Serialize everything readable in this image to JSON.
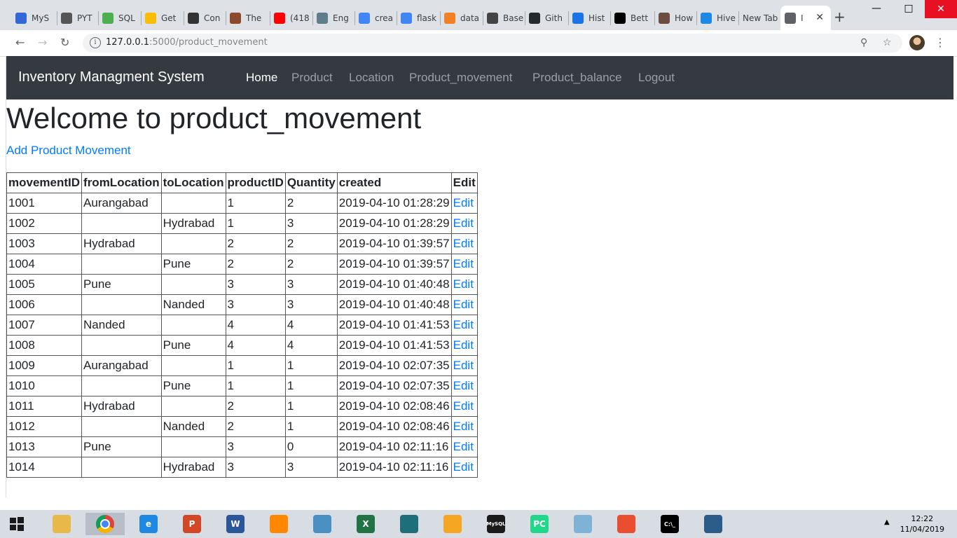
{
  "browser": {
    "tabs": [
      {
        "title": "MyS",
        "icon": "a-icon",
        "color": "#3367d6"
      },
      {
        "title": "PYT",
        "icon": "code-icon",
        "color": "#555555"
      },
      {
        "title": "SQL",
        "icon": "w3-icon",
        "color": "#4caf50"
      },
      {
        "title": "Get",
        "icon": "drive-icon",
        "color": "#fbbc04"
      },
      {
        "title": "Con",
        "icon": "phone-icon",
        "color": "#333333"
      },
      {
        "title": "The",
        "icon": "photo-icon",
        "color": "#8b4a2b"
      },
      {
        "title": "(418",
        "icon": "youtube-icon",
        "color": "#ff0000"
      },
      {
        "title": "Eng",
        "icon": "settings-icon",
        "color": "#607d8b"
      },
      {
        "title": "crea",
        "icon": "google-icon",
        "color": "#4285f4"
      },
      {
        "title": "flask",
        "icon": "google-icon",
        "color": "#4285f4"
      },
      {
        "title": "data",
        "icon": "stackoverflow-icon",
        "color": "#f48024"
      },
      {
        "title": "Base",
        "icon": "grid-icon",
        "color": "#444444"
      },
      {
        "title": "Gith",
        "icon": "github-icon",
        "color": "#24292e"
      },
      {
        "title": "Hist",
        "icon": "history-icon",
        "color": "#1a73e8"
      },
      {
        "title": "Bett",
        "icon": "medium-icon",
        "color": "#000000"
      },
      {
        "title": "How",
        "icon": "user-icon",
        "color": "#6d4c41"
      },
      {
        "title": "Hive",
        "icon": "bars-icon",
        "color": "#1e88e5"
      },
      {
        "title": "New Tab",
        "icon": "",
        "color": ""
      },
      {
        "title": "I",
        "icon": "page-icon",
        "color": "#5f6368"
      }
    ],
    "url_host": "127.0.0.1",
    "url_path": ":5000/product_movement"
  },
  "site": {
    "brand": "Inventory Managment System",
    "nav": [
      "Home",
      "Product",
      "Location",
      "Product_movement",
      "Product_balance",
      "Logout"
    ]
  },
  "page": {
    "title": "Welcome to product_movement",
    "add_link": "Add Product Movement"
  },
  "table": {
    "headers": [
      "movementID",
      "fromLocation",
      "toLocation",
      "productID",
      "Quantity",
      "created",
      "Edit"
    ],
    "rows": [
      [
        "1001",
        "Aurangabad",
        "",
        "1",
        "2",
        "2019-04-10 01:28:29",
        "Edit"
      ],
      [
        "1002",
        "",
        "Hydrabad",
        "1",
        "3",
        "2019-04-10 01:28:29",
        "Edit"
      ],
      [
        "1003",
        "Hydrabad",
        "",
        "2",
        "2",
        "2019-04-10 01:39:57",
        "Edit"
      ],
      [
        "1004",
        "",
        "Pune",
        "2",
        "2",
        "2019-04-10 01:39:57",
        "Edit"
      ],
      [
        "1005",
        "Pune",
        "",
        "3",
        "3",
        "2019-04-10 01:40:48",
        "Edit"
      ],
      [
        "1006",
        "",
        "Nanded",
        "3",
        "3",
        "2019-04-10 01:40:48",
        "Edit"
      ],
      [
        "1007",
        "Nanded",
        "",
        "4",
        "4",
        "2019-04-10 01:41:53",
        "Edit"
      ],
      [
        "1008",
        "",
        "Pune",
        "4",
        "4",
        "2019-04-10 01:41:53",
        "Edit"
      ],
      [
        "1009",
        "Aurangabad",
        "",
        "1",
        "1",
        "2019-04-10 02:07:35",
        "Edit"
      ],
      [
        "1010",
        "",
        "Pune",
        "1",
        "1",
        "2019-04-10 02:07:35",
        "Edit"
      ],
      [
        "1011",
        "Hydrabad",
        "",
        "2",
        "1",
        "2019-04-10 02:08:46",
        "Edit"
      ],
      [
        "1012",
        "",
        "Nanded",
        "2",
        "1",
        "2019-04-10 02:08:46",
        "Edit"
      ],
      [
        "1013",
        "Pune",
        "",
        "3",
        "0",
        "2019-04-10 02:11:16",
        "Edit"
      ],
      [
        "1014",
        "",
        "Hydrabad",
        "3",
        "3",
        "2019-04-10 02:11:16",
        "Edit"
      ]
    ]
  },
  "taskbar": {
    "apps": [
      {
        "name": "file-explorer-icon",
        "color": "#e8b84a",
        "label": ""
      },
      {
        "name": "chrome-icon",
        "color": "#db4437",
        "label": ""
      },
      {
        "name": "internet-explorer-icon",
        "color": "#1e88e5",
        "label": "e"
      },
      {
        "name": "powerpoint-icon",
        "color": "#d24726",
        "label": "P"
      },
      {
        "name": "word-icon",
        "color": "#2b579a",
        "label": "W"
      },
      {
        "name": "vlc-icon",
        "color": "#ff8800",
        "label": ""
      },
      {
        "name": "control-panel-icon",
        "color": "#4a90c2",
        "label": ""
      },
      {
        "name": "excel-icon",
        "color": "#217346",
        "label": "X"
      },
      {
        "name": "book-icon",
        "color": "#1f6f7a",
        "label": ""
      },
      {
        "name": "audacity-icon",
        "color": "#f5a623",
        "label": ""
      },
      {
        "name": "mysql-shell-icon",
        "color": "#1a1a1a",
        "label": "MySQL"
      },
      {
        "name": "pycharm-icon",
        "color": "#21d789",
        "label": "PC"
      },
      {
        "name": "notepad-icon",
        "color": "#7fb3d5",
        "label": ""
      },
      {
        "name": "git-gui-icon",
        "color": "#e94e31",
        "label": ""
      },
      {
        "name": "cmd-icon",
        "color": "#000000",
        "label": "C:\\_"
      },
      {
        "name": "mysql-workbench-icon",
        "color": "#2c5d8a",
        "label": ""
      }
    ],
    "time": "12:22",
    "date": "11/04/2019"
  }
}
